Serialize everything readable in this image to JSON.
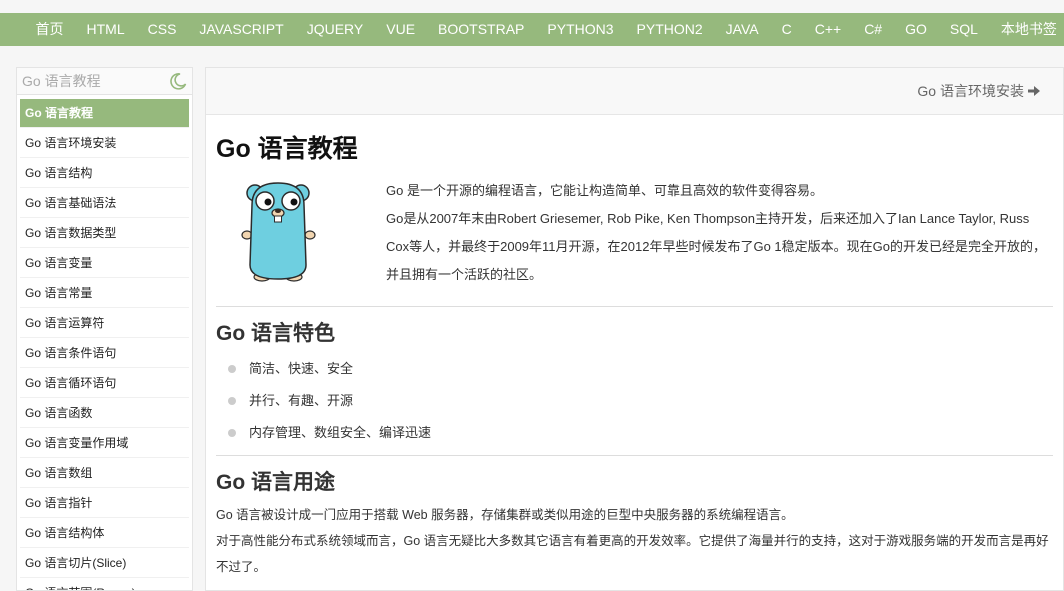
{
  "nav": {
    "items": [
      "首页",
      "HTML",
      "CSS",
      "JAVASCRIPT",
      "JQUERY",
      "VUE",
      "BOOTSTRAP",
      "PYTHON3",
      "PYTHON2",
      "JAVA",
      "C",
      "C++",
      "C#",
      "GO",
      "SQL",
      "本地书签"
    ]
  },
  "sidebar": {
    "search_placeholder": "Go 语言教程",
    "items": [
      "Go 语言教程",
      "Go 语言环境安装",
      "Go 语言结构",
      "Go 语言基础语法",
      "Go 语言数据类型",
      "Go 语言变量",
      "Go 语言常量",
      "Go 语言运算符",
      "Go 语言条件语句",
      "Go 语言循环语句",
      "Go 语言函数",
      "Go 语言变量作用域",
      "Go 语言数组",
      "Go 语言指针",
      "Go 语言结构体",
      "Go 语言切片(Slice)",
      "Go 语言范围(Range)"
    ],
    "active_index": 0
  },
  "main": {
    "next_link": "Go 语言环境安装",
    "title": "Go 语言教程",
    "intro_p1": "Go 是一个开源的编程语言，它能让构造简单、可靠且高效的软件变得容易。",
    "intro_p2": "Go是从2007年末由Robert Griesemer, Rob Pike, Ken Thompson主持开发，后来还加入了Ian Lance Taylor, Russ Cox等人，并最终于2009年11月开源，在2012年早些时候发布了Go 1稳定版本。现在Go的开发已经是完全开放的，并且拥有一个活跃的社区。",
    "features_heading": "Go 语言特色",
    "features": [
      "简洁、快速、安全",
      "并行、有趣、开源",
      "内存管理、数组安全、编译迅速"
    ],
    "usage_heading": "Go 语言用途",
    "usage_p1": "Go 语言被设计成一门应用于搭载 Web 服务器，存储集群或类似用途的巨型中央服务器的系统编程语言。",
    "usage_p2": "对于高性能分布式系统领域而言，Go 语言无疑比大多数其它语言有着更高的开发效率。它提供了海量并行的支持，这对于游戏服务端的开发而言是再好不过了。"
  },
  "colors": {
    "accent": "#96b97d"
  }
}
